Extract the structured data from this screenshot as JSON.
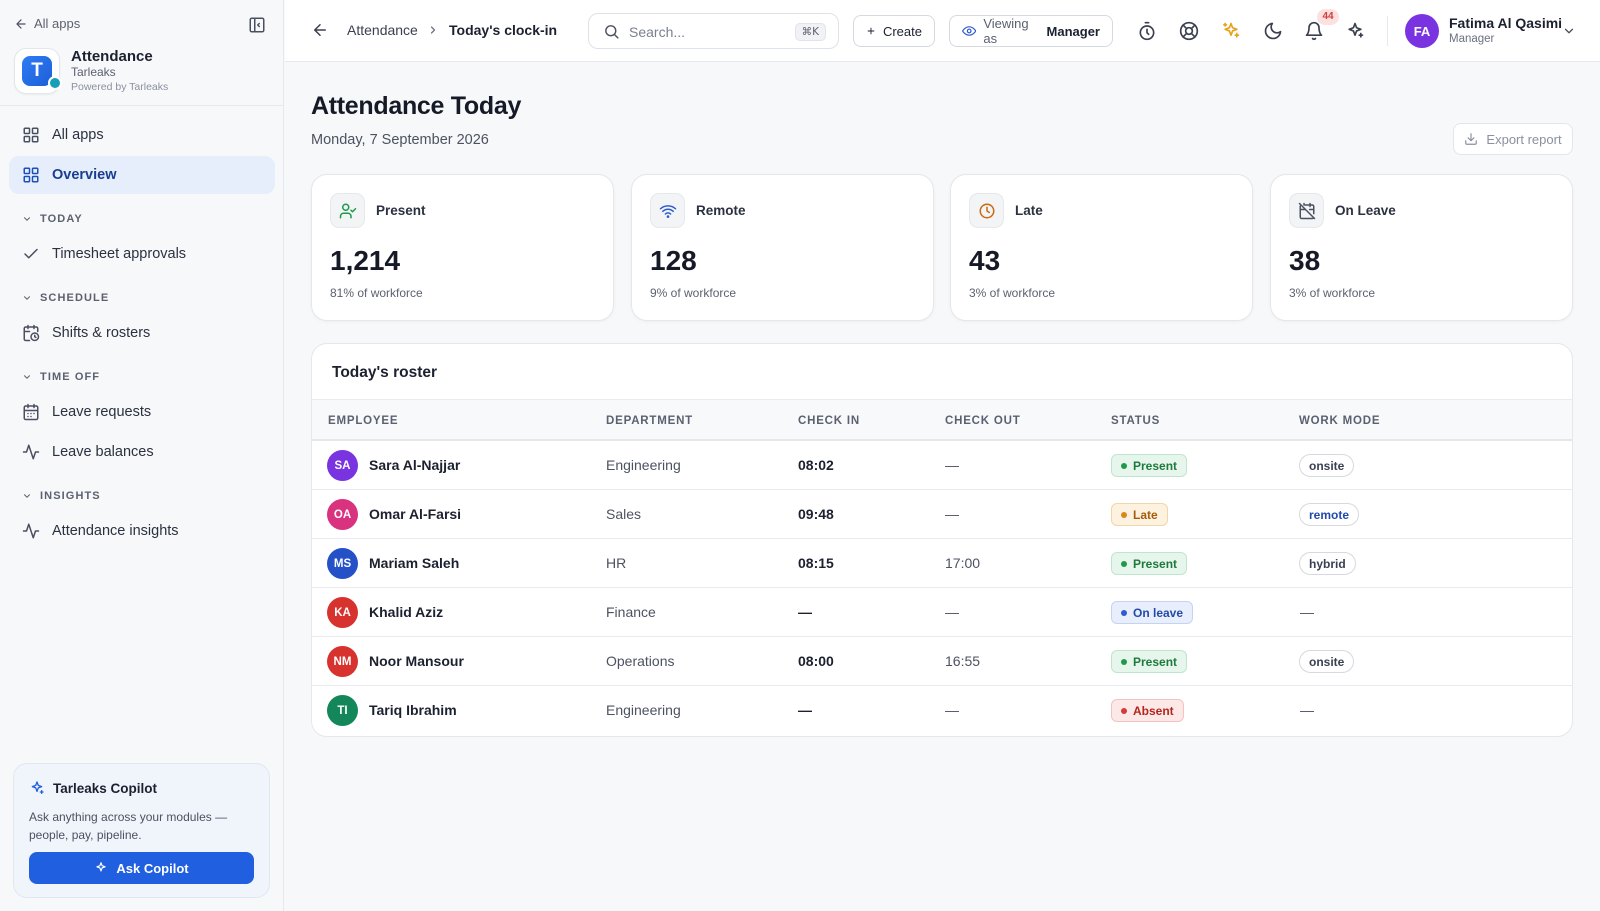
{
  "sidebar": {
    "back_label": "All apps",
    "app": {
      "name": "Attendance",
      "org": "Tarleaks",
      "powered": "Powered by Tarleaks",
      "logo_letter": "T"
    },
    "items": {
      "all_apps": "All apps",
      "overview": "Overview",
      "timesheet": "Timesheet approvals",
      "shifts": "Shifts & rosters",
      "leave_requests": "Leave requests",
      "leave_balances": "Leave balances",
      "insights": "Attendance insights"
    },
    "sections": {
      "today": "TODAY",
      "schedule": "SCHEDULE",
      "time_off": "TIME OFF",
      "insights": "INSIGHTS"
    },
    "copilot": {
      "title": "Tarleaks Copilot",
      "description": "Ask anything across your modules — people, pay, pipeline.",
      "button": "Ask Copilot"
    }
  },
  "topbar": {
    "breadcrumb": [
      "Attendance",
      "Today's clock-in"
    ],
    "search": {
      "placeholder": "Search...",
      "shortcut": "⌘K"
    },
    "create_label": "Create",
    "viewing_as": {
      "prefix": "Viewing as",
      "role": "Manager"
    },
    "notifications_count": "44",
    "user": {
      "initials": "FA",
      "name": "Fatima Al Qasimi",
      "role": "Manager"
    }
  },
  "page": {
    "title": "Attendance Today",
    "date": "Monday, 7 September 2026",
    "export_label": "Export report"
  },
  "stats": [
    {
      "label": "Present",
      "value": "1,214",
      "sub": "81% of workforce",
      "icon": "user-check-icon"
    },
    {
      "label": "Remote",
      "value": "128",
      "sub": "9% of workforce",
      "icon": "wifi-icon"
    },
    {
      "label": "Late",
      "value": "43",
      "sub": "3% of workforce",
      "icon": "clock-icon"
    },
    {
      "label": "On Leave",
      "value": "38",
      "sub": "3% of workforce",
      "icon": "calendar-off-icon"
    }
  ],
  "roster": {
    "title": "Today's roster",
    "columns": [
      "EMPLOYEE",
      "DEPARTMENT",
      "CHECK IN",
      "CHECK OUT",
      "STATUS",
      "WORK MODE"
    ],
    "rows": [
      {
        "initials": "SA",
        "name": "Sara Al-Najjar",
        "department": "Engineering",
        "check_in": "08:02",
        "check_out": "—",
        "status": "Present",
        "work_mode": "onsite"
      },
      {
        "initials": "OA",
        "name": "Omar Al-Farsi",
        "department": "Sales",
        "check_in": "09:48",
        "check_out": "—",
        "status": "Late",
        "work_mode": "remote"
      },
      {
        "initials": "MS",
        "name": "Mariam Saleh",
        "department": "HR",
        "check_in": "08:15",
        "check_out": "17:00",
        "status": "Present",
        "work_mode": "hybrid"
      },
      {
        "initials": "KA",
        "name": "Khalid Aziz",
        "department": "Finance",
        "check_in": "—",
        "check_out": "—",
        "status": "On leave",
        "work_mode": "—"
      },
      {
        "initials": "NM",
        "name": "Noor Mansour",
        "department": "Operations",
        "check_in": "08:00",
        "check_out": "16:55",
        "status": "Present",
        "work_mode": "onsite"
      },
      {
        "initials": "TI",
        "name": "Tariq Ibrahim",
        "department": "Engineering",
        "check_in": "—",
        "check_out": "—",
        "status": "Absent",
        "work_mode": "—"
      }
    ]
  },
  "colors": {
    "accent": "#1f5fe0",
    "present": "#1e9a4a",
    "late": "#d9861a",
    "on_leave": "#2d5bd0",
    "absent": "#d23b3b",
    "avatars": [
      "#7a33e0",
      "#d9327f",
      "#2450c8",
      "#d8322f",
      "#d8322f",
      "#13875a"
    ]
  }
}
